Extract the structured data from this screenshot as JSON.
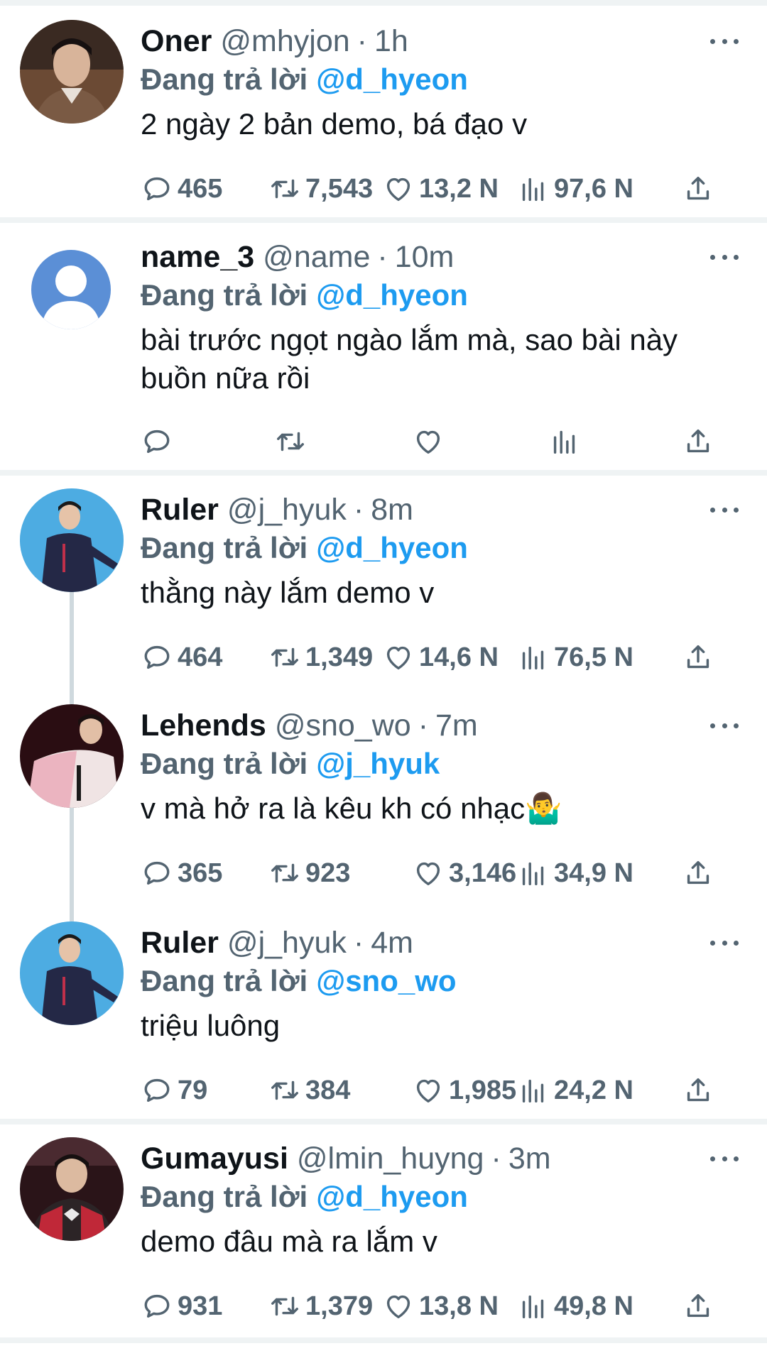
{
  "tweets": [
    {
      "name": "Oner",
      "handle": "@mhyjon",
      "time": "1h",
      "reply_lead": "Đang trả lời",
      "reply_to": "@d_hyeon",
      "text": "2 ngày 2 bản demo, bá đạo v",
      "replies": "465",
      "retweets": "7,543",
      "likes": "13,2 N",
      "views": "97,6 N"
    },
    {
      "name": "name_3",
      "handle": "@name",
      "time": "10m",
      "reply_lead": "Đang trả lời",
      "reply_to": "@d_hyeon",
      "text": "bài trước ngọt ngào lắm mà, sao bài này buồn nữa rồi",
      "replies": "",
      "retweets": "",
      "likes": "",
      "views": ""
    },
    {
      "name": "Ruler",
      "handle": "@j_hyuk",
      "time": "8m",
      "reply_lead": "Đang trả lời",
      "reply_to": "@d_hyeon",
      "text": "thằng này lắm demo v",
      "replies": "464",
      "retweets": "1,349",
      "likes": "14,6 N",
      "views": "76,5 N"
    },
    {
      "name": "Lehends",
      "handle": "@sno_wo",
      "time": "7m",
      "reply_lead": "Đang trả lời",
      "reply_to": "@j_hyuk",
      "text": "v mà hở ra là kêu kh có nhạc🤷‍♂️",
      "replies": "365",
      "retweets": "923",
      "likes": "3,146",
      "views": "34,9 N"
    },
    {
      "name": "Ruler",
      "handle": "@j_hyuk",
      "time": "4m",
      "reply_lead": "Đang trả lời",
      "reply_to": "@sno_wo",
      "text": "triệu luông",
      "replies": "79",
      "retweets": "384",
      "likes": "1,985",
      "views": "24,2 N"
    },
    {
      "name": "Gumayusi",
      "handle": "@lmin_huyng",
      "time": "3m",
      "reply_lead": "Đang trả lời",
      "reply_to": "@d_hyeon",
      "text": "demo đâu mà ra lắm v",
      "replies": "931",
      "retweets": "1,379",
      "likes": "13,8 N",
      "views": "49,8 N"
    }
  ],
  "header_separator": "·",
  "icons": {
    "reply": "speech-bubble-icon",
    "retweet": "retweet-arrows-icon",
    "like": "heart-icon",
    "views": "bar-chart-icon",
    "share": "share-upload-icon",
    "more": "three-dots-icon"
  },
  "colors": {
    "accent": "#1d9bf0",
    "muted": "#536471",
    "text": "#0f1419",
    "divider": "#eff3f4"
  }
}
